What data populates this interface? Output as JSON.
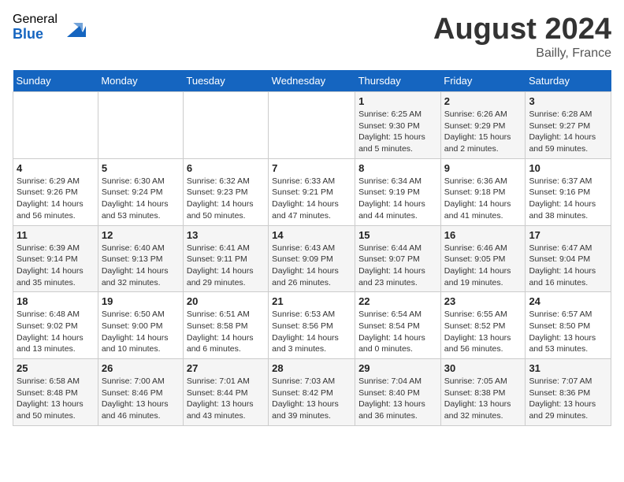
{
  "header": {
    "logo_general": "General",
    "logo_blue": "Blue",
    "month_year": "August 2024",
    "location": "Bailly, France"
  },
  "weekdays": [
    "Sunday",
    "Monday",
    "Tuesday",
    "Wednesday",
    "Thursday",
    "Friday",
    "Saturday"
  ],
  "weeks": [
    [
      {
        "day": "",
        "info": ""
      },
      {
        "day": "",
        "info": ""
      },
      {
        "day": "",
        "info": ""
      },
      {
        "day": "",
        "info": ""
      },
      {
        "day": "1",
        "info": "Sunrise: 6:25 AM\nSunset: 9:30 PM\nDaylight: 15 hours\nand 5 minutes."
      },
      {
        "day": "2",
        "info": "Sunrise: 6:26 AM\nSunset: 9:29 PM\nDaylight: 15 hours\nand 2 minutes."
      },
      {
        "day": "3",
        "info": "Sunrise: 6:28 AM\nSunset: 9:27 PM\nDaylight: 14 hours\nand 59 minutes."
      }
    ],
    [
      {
        "day": "4",
        "info": "Sunrise: 6:29 AM\nSunset: 9:26 PM\nDaylight: 14 hours\nand 56 minutes."
      },
      {
        "day": "5",
        "info": "Sunrise: 6:30 AM\nSunset: 9:24 PM\nDaylight: 14 hours\nand 53 minutes."
      },
      {
        "day": "6",
        "info": "Sunrise: 6:32 AM\nSunset: 9:23 PM\nDaylight: 14 hours\nand 50 minutes."
      },
      {
        "day": "7",
        "info": "Sunrise: 6:33 AM\nSunset: 9:21 PM\nDaylight: 14 hours\nand 47 minutes."
      },
      {
        "day": "8",
        "info": "Sunrise: 6:34 AM\nSunset: 9:19 PM\nDaylight: 14 hours\nand 44 minutes."
      },
      {
        "day": "9",
        "info": "Sunrise: 6:36 AM\nSunset: 9:18 PM\nDaylight: 14 hours\nand 41 minutes."
      },
      {
        "day": "10",
        "info": "Sunrise: 6:37 AM\nSunset: 9:16 PM\nDaylight: 14 hours\nand 38 minutes."
      }
    ],
    [
      {
        "day": "11",
        "info": "Sunrise: 6:39 AM\nSunset: 9:14 PM\nDaylight: 14 hours\nand 35 minutes."
      },
      {
        "day": "12",
        "info": "Sunrise: 6:40 AM\nSunset: 9:13 PM\nDaylight: 14 hours\nand 32 minutes."
      },
      {
        "day": "13",
        "info": "Sunrise: 6:41 AM\nSunset: 9:11 PM\nDaylight: 14 hours\nand 29 minutes."
      },
      {
        "day": "14",
        "info": "Sunrise: 6:43 AM\nSunset: 9:09 PM\nDaylight: 14 hours\nand 26 minutes."
      },
      {
        "day": "15",
        "info": "Sunrise: 6:44 AM\nSunset: 9:07 PM\nDaylight: 14 hours\nand 23 minutes."
      },
      {
        "day": "16",
        "info": "Sunrise: 6:46 AM\nSunset: 9:05 PM\nDaylight: 14 hours\nand 19 minutes."
      },
      {
        "day": "17",
        "info": "Sunrise: 6:47 AM\nSunset: 9:04 PM\nDaylight: 14 hours\nand 16 minutes."
      }
    ],
    [
      {
        "day": "18",
        "info": "Sunrise: 6:48 AM\nSunset: 9:02 PM\nDaylight: 14 hours\nand 13 minutes."
      },
      {
        "day": "19",
        "info": "Sunrise: 6:50 AM\nSunset: 9:00 PM\nDaylight: 14 hours\nand 10 minutes."
      },
      {
        "day": "20",
        "info": "Sunrise: 6:51 AM\nSunset: 8:58 PM\nDaylight: 14 hours\nand 6 minutes."
      },
      {
        "day": "21",
        "info": "Sunrise: 6:53 AM\nSunset: 8:56 PM\nDaylight: 14 hours\nand 3 minutes."
      },
      {
        "day": "22",
        "info": "Sunrise: 6:54 AM\nSunset: 8:54 PM\nDaylight: 14 hours\nand 0 minutes."
      },
      {
        "day": "23",
        "info": "Sunrise: 6:55 AM\nSunset: 8:52 PM\nDaylight: 13 hours\nand 56 minutes."
      },
      {
        "day": "24",
        "info": "Sunrise: 6:57 AM\nSunset: 8:50 PM\nDaylight: 13 hours\nand 53 minutes."
      }
    ],
    [
      {
        "day": "25",
        "info": "Sunrise: 6:58 AM\nSunset: 8:48 PM\nDaylight: 13 hours\nand 50 minutes."
      },
      {
        "day": "26",
        "info": "Sunrise: 7:00 AM\nSunset: 8:46 PM\nDaylight: 13 hours\nand 46 minutes."
      },
      {
        "day": "27",
        "info": "Sunrise: 7:01 AM\nSunset: 8:44 PM\nDaylight: 13 hours\nand 43 minutes."
      },
      {
        "day": "28",
        "info": "Sunrise: 7:03 AM\nSunset: 8:42 PM\nDaylight: 13 hours\nand 39 minutes."
      },
      {
        "day": "29",
        "info": "Sunrise: 7:04 AM\nSunset: 8:40 PM\nDaylight: 13 hours\nand 36 minutes."
      },
      {
        "day": "30",
        "info": "Sunrise: 7:05 AM\nSunset: 8:38 PM\nDaylight: 13 hours\nand 32 minutes."
      },
      {
        "day": "31",
        "info": "Sunrise: 7:07 AM\nSunset: 8:36 PM\nDaylight: 13 hours\nand 29 minutes."
      }
    ]
  ]
}
